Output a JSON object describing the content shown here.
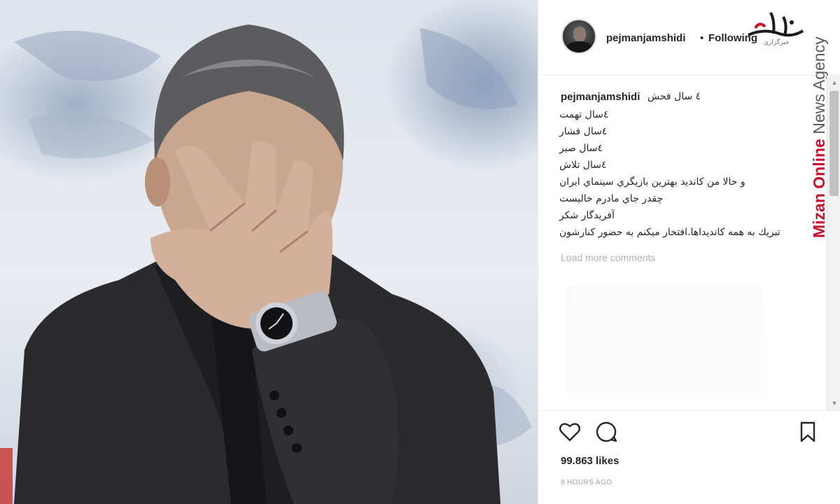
{
  "photo": {
    "alt": "",
    "colors": {
      "background": "#e3e7ee",
      "coat": "#2a2a2c",
      "skin": "#c9a896",
      "hair": "#5a5a5a"
    }
  },
  "post": {
    "username": "pejmanjamshidi",
    "separator": "•",
    "follow_status": "Following",
    "caption_lines": [
      "٤ سال فحش",
      "٤سال تهمت",
      "٤سال فشار",
      "٤سال صبر",
      "٤سال تلاش",
      "و حالا من كانديد بهترين بازيگري سينماي ايران",
      "چقدر جاي مادرم خاليست",
      "آفريدگار شكر",
      "تبريك به همه كانديداها.افتخار ميكنم به حضور كنارشون"
    ],
    "load_more": "Load more comments",
    "likes": "99.863 likes",
    "timestamp": "8 HOURS AGO"
  },
  "watermark": {
    "logo_subtext": "خبرگزاری",
    "brand_red": "Mizan Online",
    "brand_grey": "News Agency",
    "colors": {
      "red": "#c8102e",
      "grey": "#5a5a5a"
    }
  },
  "icons": {
    "like": "heart-outline-icon",
    "comment": "speech-bubble-icon",
    "save": "bookmark-outline-icon",
    "scroll_up": "▲",
    "scroll_down": "▼"
  }
}
